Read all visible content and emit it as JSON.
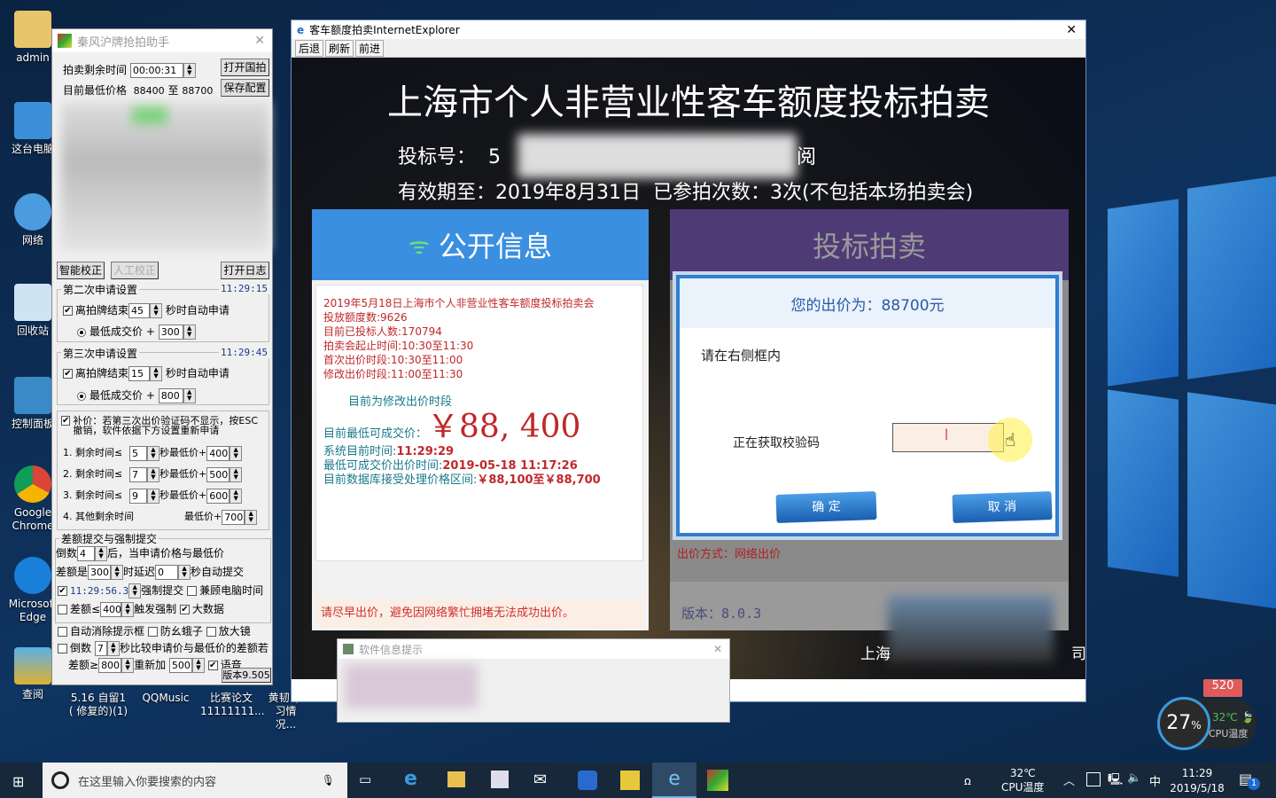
{
  "desktop": {
    "icons": [
      {
        "label": "admin"
      },
      {
        "label": "这台电脑"
      },
      {
        "label": "网络"
      },
      {
        "label": "回收站"
      },
      {
        "label": "控制面板"
      },
      {
        "label": "Google Chrome"
      },
      {
        "label": "Microsoft Edge"
      },
      {
        "label": "查阅"
      },
      {
        "label": "5.16 自留1 ( 修复的)(1)"
      },
      {
        "label": "QQMusic"
      },
      {
        "label": "比赛论文 11111111..."
      },
      {
        "label": "黄韧 学习情况..."
      }
    ]
  },
  "helper": {
    "title": "秦风沪牌抢拍助手",
    "remain_label": "拍卖剩余时间",
    "remain_value": "00:00:31",
    "open_btn": "打开国拍",
    "price_label": "目前最低价格",
    "price_low": "88400",
    "price_to": "至",
    "price_high": "88700",
    "save_btn": "保存配置",
    "smart_btn": "智能校正",
    "manual_btn": "人工校正",
    "log_btn": "打开日志",
    "second": {
      "title": "第二次申请设置",
      "time": "11:29:15",
      "prefix": "离拍牌结束",
      "seconds": "45",
      "suffix": "秒时自动申请",
      "price_label": "最低成交价 +",
      "price_add": "300"
    },
    "third": {
      "title": "第三次申请设置",
      "time": "11:29:45",
      "prefix": "离拍牌结束",
      "seconds": "15",
      "suffix": "秒时自动申请",
      "price_label": "最低成交价 +",
      "price_add": "800"
    },
    "supplement": {
      "text": "补价：若第三次出价验证码不显示，按ESC撤销，软件依据下方设置重新申请",
      "rows": [
        {
          "label": "1.  剩余时间≤",
          "sec": "5",
          "mid": "秒最低价+",
          "add": "400"
        },
        {
          "label": "2.  剩余时间≤",
          "sec": "7",
          "mid": "秒最低价+",
          "add": "500"
        },
        {
          "label": "3.  剩余时间≤",
          "sec": "9",
          "mid": "秒最低价+",
          "add": "600"
        },
        {
          "label": "4.  其他剩余时间",
          "sec": "",
          "mid": "最低价+",
          "add": "700"
        }
      ]
    },
    "diff": {
      "title": "差额提交与强制提交",
      "countdown_label": "倒数",
      "countdown": "4",
      "after": "后，当申请价格与最低价",
      "diff_label": "差额是",
      "diff": "300",
      "delay_label": "时延迟",
      "delay": "0",
      "auto_submit": "秒自动提交",
      "force_time": "11:29:56.3",
      "force_label": "强制提交",
      "pc_time": "兼顾电脑时间",
      "diff_le": "差额≤",
      "diff_le_val": "400",
      "trigger": "触发强制",
      "bigdata": "大数据"
    },
    "auto_close": "自动消除提示框",
    "anti": "防幺蛾子",
    "magnifier": "放大镜",
    "cmp_label": "倒数",
    "cmp_sec": "7",
    "cmp_text": "秒比较申请价与最低价的差额若",
    "ge_label": "差额≥",
    "ge_val": "800",
    "readd_label": "重新加",
    "readd_val": "500",
    "voice": "语音",
    "version": "版本9.505"
  },
  "ie": {
    "title": "客车额度拍卖InternetExplorer",
    "back": "后退",
    "refresh": "刷新",
    "forward": "前进",
    "heading": "上海市个人非营业性客车额度投标拍卖",
    "bid_no_label": "投标号：",
    "bid_no_prefix": "5",
    "bid_no_suffix": "阅",
    "valid": "有效期至：2019年8月31日",
    "count": "已参拍次数：3次(不包括本场拍卖会)",
    "public": {
      "title": "公开信息",
      "lines": [
        "2019年5月18日上海市个人非营业性客车额度投标拍卖会",
        "投放额度数:9626",
        "目前已投标人数:170794",
        "拍卖会起止时间:10:30至11:30",
        "首次出价时段:10:30至11:00",
        "修改出价时段:11:00至11:30"
      ],
      "phase": "目前为修改出价时段",
      "lowest_label": "目前最低可成交价：",
      "lowest": "￥88, 400",
      "systime_label": "系统目前时间:",
      "systime": "11:29:29",
      "lowtime_label": "最低可成交价出价时间:",
      "lowtime": "2019-05-18  11:17:26",
      "range_label": "目前数据库接受处理价格区间:",
      "range": "￥88,100至￥88,700",
      "notice": "请尽早出价，避免因网络繁忙拥堵无法成功出价。"
    },
    "bid": {
      "title": "投标拍卖",
      "dialog_title": "您的出价为：88700元",
      "prompt": "请在右侧框内",
      "captcha_label": "正在获取校验码",
      "captcha_value": "",
      "confirm": "确  定",
      "cancel": "取  消",
      "method": "出价方式：网络出价",
      "version": "版本：8.0.3"
    },
    "footer_left": "上海",
    "footer_right": "司"
  },
  "popup": {
    "title": "软件信息提示"
  },
  "widget": {
    "cpu_percent": "27",
    "unit": "%",
    "temp": "32℃",
    "temp_label": "CPU温度",
    "gift": "520"
  },
  "taskbar": {
    "search_placeholder": "在这里输入你要搜索的内容",
    "temp": "32℃",
    "temp_label": "CPU温度",
    "ime": "中",
    "time": "11:29",
    "date": "2019/5/18",
    "notif_count": "1"
  }
}
